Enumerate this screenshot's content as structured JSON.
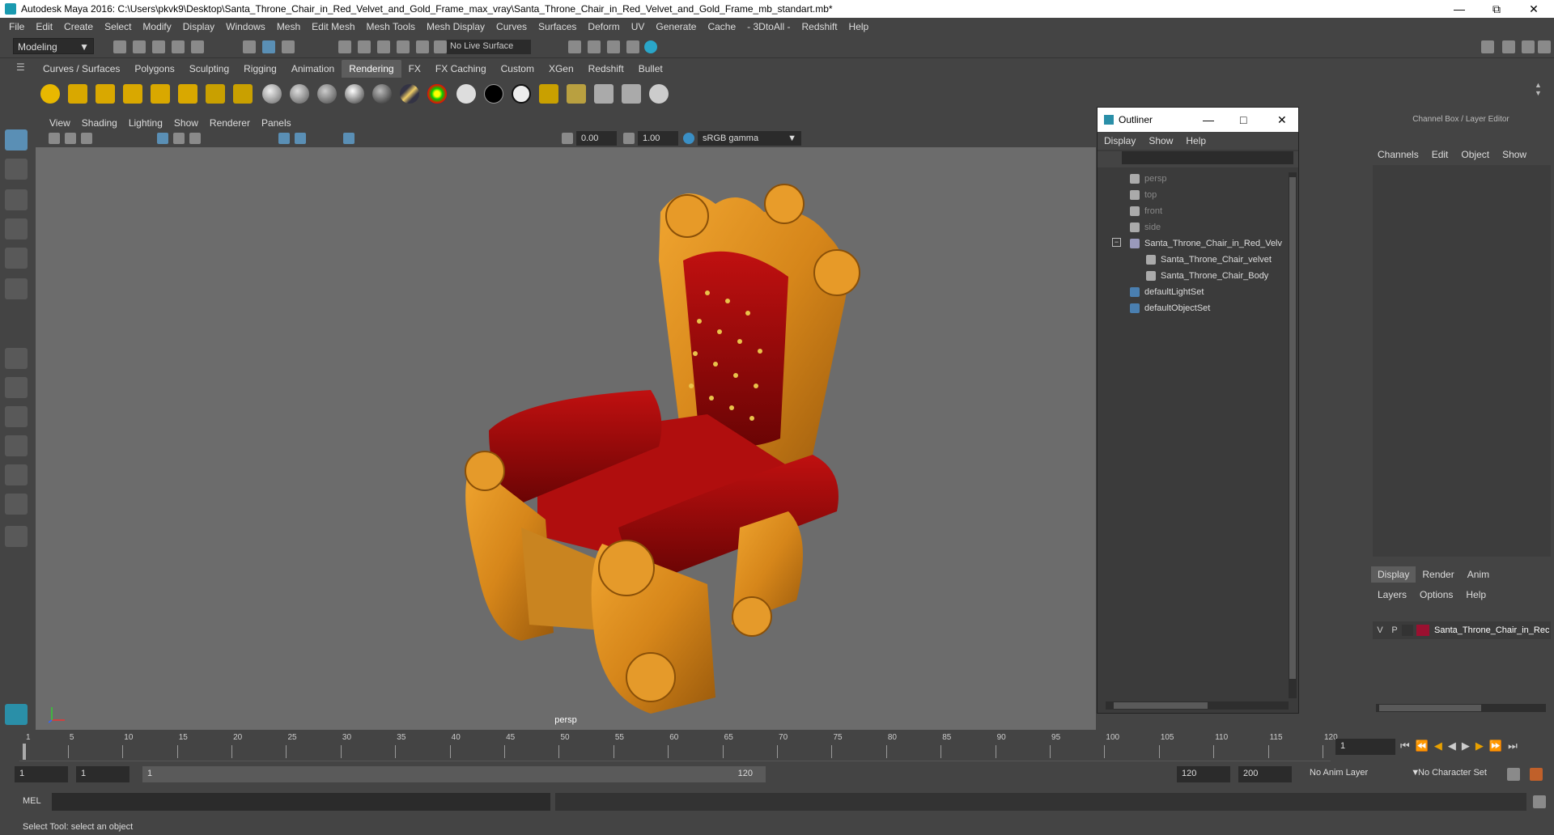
{
  "window": {
    "title": "Autodesk Maya 2016: C:\\Users\\pkvk9\\Desktop\\Santa_Throne_Chair_in_Red_Velvet_and_Gold_Frame_max_vray\\Santa_Throne_Chair_in_Red_Velvet_and_Gold_Frame_mb_standart.mb*"
  },
  "menubar": [
    "File",
    "Edit",
    "Create",
    "Select",
    "Modify",
    "Display",
    "Windows",
    "Mesh",
    "Edit Mesh",
    "Mesh Tools",
    "Mesh Display",
    "Curves",
    "Surfaces",
    "Deform",
    "UV",
    "Generate",
    "Cache",
    "- 3DtoAll -",
    "Redshift",
    "Help"
  ],
  "statusline": {
    "mode": "Modeling",
    "live_surface": "No Live Surface"
  },
  "shelf_tabs": [
    "Curves / Surfaces",
    "Polygons",
    "Sculpting",
    "Rigging",
    "Animation",
    "Rendering",
    "FX",
    "FX Caching",
    "Custom",
    "XGen",
    "Redshift",
    "Bullet"
  ],
  "shelf_active": "Rendering",
  "viewport": {
    "menu": [
      "View",
      "Shading",
      "Lighting",
      "Show",
      "Renderer",
      "Panels"
    ],
    "exposure": "0.00",
    "gamma": "1.00",
    "color_space": "sRGB gamma",
    "camera_label": "persp"
  },
  "outliner": {
    "title": "Outliner",
    "menu": [
      "Display",
      "Show",
      "Help"
    ],
    "items": [
      {
        "label": "persp",
        "indent": 1,
        "icon": "camera-icon",
        "dim": true
      },
      {
        "label": "top",
        "indent": 1,
        "icon": "camera-icon",
        "dim": true
      },
      {
        "label": "front",
        "indent": 1,
        "icon": "camera-icon",
        "dim": true
      },
      {
        "label": "side",
        "indent": 1,
        "icon": "camera-icon",
        "dim": true
      },
      {
        "label": "Santa_Throne_Chair_in_Red_Velv",
        "indent": 1,
        "icon": "group-icon",
        "dim": false
      },
      {
        "label": "Santa_Throne_Chair_velvet",
        "indent": 2,
        "icon": "mesh-icon",
        "dim": false
      },
      {
        "label": "Santa_Throne_Chair_Body",
        "indent": 2,
        "icon": "mesh-icon",
        "dim": false
      },
      {
        "label": "defaultLightSet",
        "indent": 1,
        "icon": "set-icon",
        "dim": false
      },
      {
        "label": "defaultObjectSet",
        "indent": 1,
        "icon": "set-icon",
        "dim": false
      }
    ]
  },
  "channelbox": {
    "title": "Channel Box / Layer Editor",
    "menu": [
      "Channels",
      "Edit",
      "Object",
      "Show"
    ],
    "layer_tabs": [
      "Display",
      "Render",
      "Anim"
    ],
    "layer_menu": [
      "Layers",
      "Options",
      "Help"
    ],
    "layer": {
      "v": "V",
      "p": "P",
      "name": "Santa_Throne_Chair_in_Rec",
      "color": "#9b1030"
    }
  },
  "timeslider": {
    "ticks": [
      "1",
      "5",
      "10",
      "15",
      "20",
      "25",
      "30",
      "35",
      "40",
      "45",
      "50",
      "55",
      "60",
      "65",
      "70",
      "75",
      "80",
      "85",
      "90",
      "95",
      "100",
      "105",
      "110",
      "115",
      "120"
    ],
    "current_frame": "1"
  },
  "range": {
    "start": "1",
    "playback_start": "1",
    "slider_start": "1",
    "slider_end": "120",
    "playback_end": "120",
    "end": "200",
    "anim_layer": "No Anim Layer",
    "character_set": "No Character Set"
  },
  "cmdline": {
    "label": "MEL"
  },
  "helpline": {
    "text": "Select Tool: select an object"
  }
}
